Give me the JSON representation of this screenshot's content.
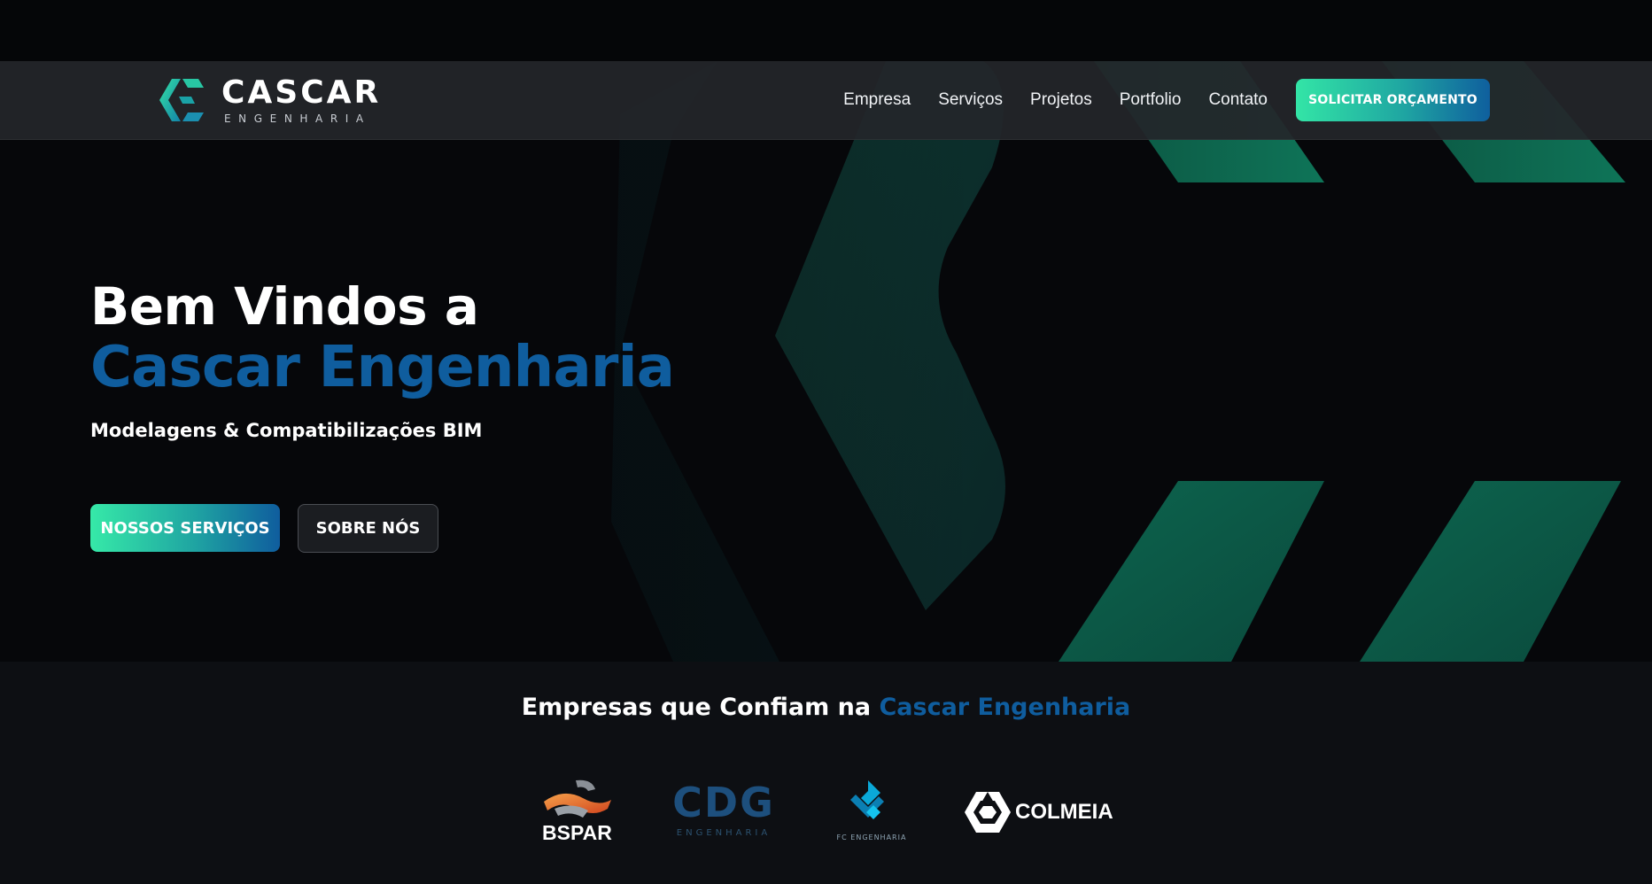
{
  "brand": {
    "name": "CASCAR",
    "tagline": "ENGENHARIA",
    "accent_color": "#0f5d9e",
    "gradient_start": "#33e5a6",
    "gradient_end": "#0f5f9e"
  },
  "nav": {
    "items": [
      {
        "label": "Empresa"
      },
      {
        "label": "Serviços"
      },
      {
        "label": "Projetos"
      },
      {
        "label": "Portfolio"
      },
      {
        "label": "Contato"
      }
    ],
    "cta_label": "SOLICITAR ORÇAMENTO"
  },
  "hero": {
    "title_line1": "Bem Vindos a",
    "title_line2": "Cascar Engenharia",
    "subtitle": "Modelagens & Compatibilizações BIM",
    "primary_button": "NOSSOS SERVIÇOS",
    "secondary_button": "SOBRE NÓS"
  },
  "clients": {
    "title_prefix": "Empresas que Confiam na",
    "title_accent": "Cascar Engenharia",
    "logos": [
      {
        "name": "BSPAR"
      },
      {
        "name": "CDG",
        "sub": "ENGENHARIA"
      },
      {
        "name": "FC ENGENHARIA"
      },
      {
        "name": "COLMEIA"
      }
    ]
  }
}
